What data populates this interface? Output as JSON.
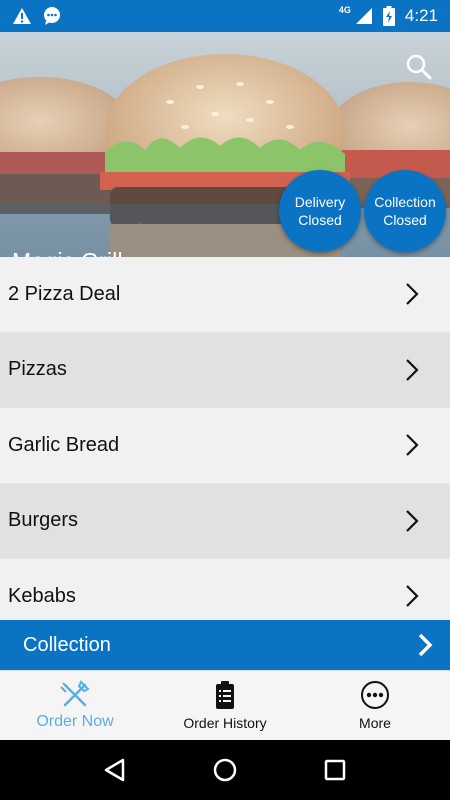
{
  "status_bar": {
    "time": "4:21",
    "network": "4G",
    "icons": [
      "warning-icon",
      "chat-icon",
      "signal-icon",
      "battery-icon"
    ]
  },
  "hero": {
    "restaurant_name": "Magic Grill",
    "search_icon": "search-icon",
    "delivery": {
      "line1": "Delivery",
      "line2": "Closed"
    },
    "collection": {
      "line1": "Collection",
      "line2": "Closed"
    }
  },
  "menu": {
    "categories": [
      {
        "label": "2 Pizza Deal"
      },
      {
        "label": "Pizzas"
      },
      {
        "label": "Garlic Bread"
      },
      {
        "label": "Burgers"
      },
      {
        "label": "Kebabs"
      }
    ]
  },
  "collection_bar": {
    "label": "Collection"
  },
  "bottom_nav": {
    "items": [
      {
        "label": "Order Now",
        "icon": "fork-knife-icon",
        "active": true
      },
      {
        "label": "Order History",
        "icon": "clipboard-icon",
        "active": false
      },
      {
        "label": "More",
        "icon": "more-dots-icon",
        "active": false
      }
    ]
  },
  "colors": {
    "primary": "#0a73c4",
    "active_nav": "#5aaee6",
    "row_light": "#f1f1f1",
    "row_dark": "#e1e1e1"
  }
}
